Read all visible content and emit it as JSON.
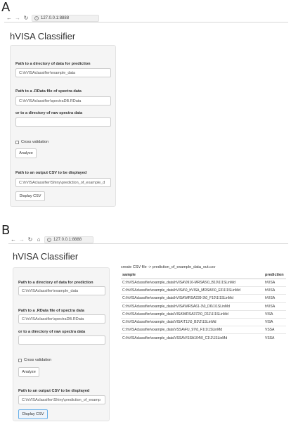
{
  "panel_a": {
    "letter": "A",
    "url": "127.0.0.1:8888",
    "title": "hVISA Classifier",
    "data_dir_label": "Path to a directory of data for prediction",
    "data_dir_value": "C:\\hVISAclassifier\\example_data",
    "rdata_label": "Path to a .RData file of spectra data",
    "rdata_value": "C:\\hVISAclassifier\\spectraDB.RData",
    "raw_dir_label": "or to a directory of raw spectra data",
    "raw_dir_value": "",
    "cross_validation_label": "Cross validation",
    "analyze_label": "Analyze",
    "output_csv_label": "Path to an output CSV to be displayed",
    "output_csv_value": "C:\\hVISAclassifier\\Shiny\\prediction_of_example_d",
    "display_csv_label": "Display CSV"
  },
  "panel_b": {
    "letter": "B",
    "url": "127.0.0.1:8888",
    "title": "hVISA Classifier",
    "data_dir_label": "Path to a directory of data for prediction",
    "data_dir_value": "C:\\hVISAclassifier\\example_data",
    "rdata_label": "Path to a .RData file of spectra data",
    "rdata_value": "C:\\hVISAclassifier\\spectraDB.RData",
    "raw_dir_label": "or to a directory of raw spectra data",
    "raw_dir_value": "",
    "cross_validation_label": "Cross validation",
    "analyze_label": "Analyze",
    "output_csv_label": "Path to an output CSV to be displayed",
    "output_csv_value": "C:\\hVISAclassifier\\Shiny\\prediction_of_examp",
    "display_csv_label": "Display CSV",
    "status": "create CSV file -> prediction_of_example_data_out.csv",
    "table": {
      "headers": [
        "sample",
        "prediction"
      ],
      "rows": [
        [
          "C:\\hVISAclassifier\\example_data\\hVISA\\0916-MRSA5\\0_B10\\1\\1SLinMd",
          "hVISA"
        ],
        [
          "C:\\hVISAclassifier\\example_data\\hVISA\\0_hVISA_MRSA5\\0_E6\\1\\1SLinMd",
          "hVISA"
        ],
        [
          "C:\\hVISAclassifier\\example_data\\hVISA\\MRSA239-3\\0_F10\\1\\1SLinMd",
          "hVISA"
        ],
        [
          "C:\\hVISAclassifier\\example_data\\hVISA\\MRSA61-3\\0_D6\\1\\1SLinMd",
          "hVISA"
        ],
        [
          "C:\\hVISAclassifier\\example_data\\VISA\\MRSA372\\0_D11\\1\\1SLinMd",
          "VISA"
        ],
        [
          "C:\\hVISAclassifier\\example_data\\VISA\\T11\\0_B3\\2\\1SLinMd",
          "VISA"
        ],
        [
          "C:\\hVISAclassifier\\example_data\\VSSA\\FU_97\\0_F1\\1\\1SLinMd",
          "VSSA"
        ],
        [
          "C:\\hVISAclassifier\\example_data\\VSSA\\VSSA104\\0_C1\\1\\1SLinMd",
          "VSSA"
        ]
      ]
    }
  }
}
